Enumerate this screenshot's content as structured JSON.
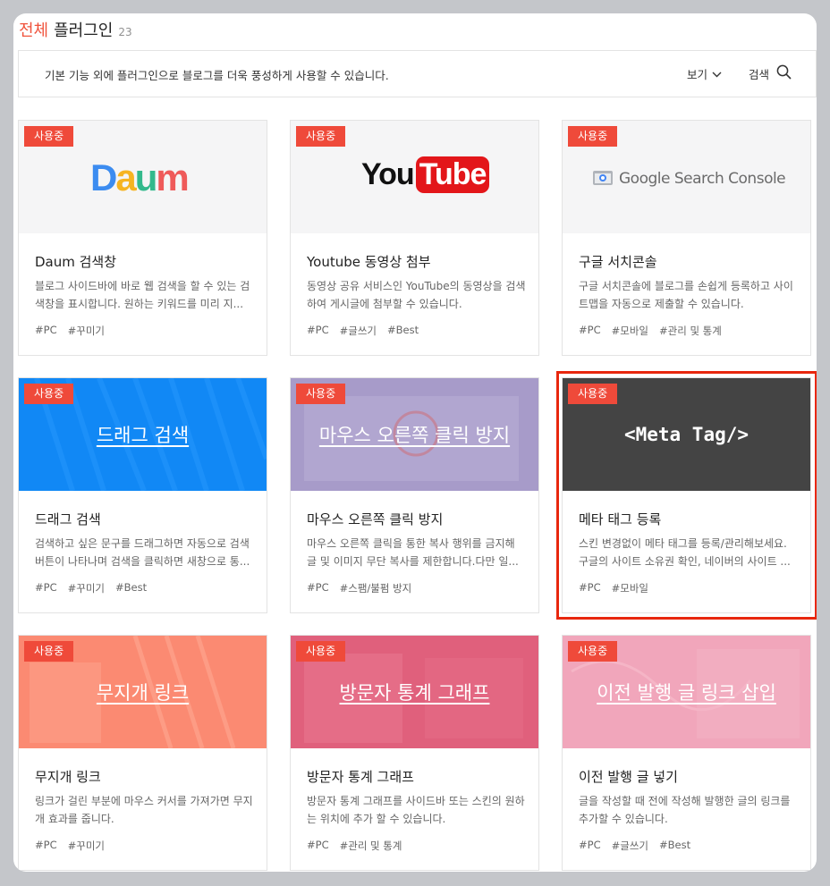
{
  "header": {
    "all_label": "전체",
    "plugin_label": "플러그인",
    "count": "23"
  },
  "toolbar": {
    "description": "기본 기능 외에 플러그인으로 블로그를 더욱 풍성하게 사용할 수 있습니다.",
    "view_label": "보기",
    "search_label": "검색"
  },
  "cards": [
    {
      "badge": "사용중",
      "logo": "Daum",
      "title": "Daum 검색창",
      "desc": "블로그 사이드바에 바로 웹 검색을 할 수 있는 검색창을 표시합니다. 원하는 키워드를 미리 지...",
      "tags": [
        "#PC",
        "#꾸미기"
      ]
    },
    {
      "badge": "사용중",
      "logo_a": "You",
      "logo_b": "Tube",
      "title": "Youtube 동영상 첨부",
      "desc": "동영상 공유 서비스인 YouTube의 동영상을 검색하여 게시글에 첨부할 수 있습니다.",
      "tags": [
        "#PC",
        "#글쓰기",
        "#Best"
      ]
    },
    {
      "badge": "사용중",
      "logo": "Google Search Console",
      "title": "구글 서치콘솔",
      "desc": "구글 서치콘솔에 블로그를 손쉽게 등록하고 사이트맵을 자동으로 제출할 수 있습니다.",
      "tags": [
        "#PC",
        "#모바일",
        "#관리 및 통계"
      ]
    },
    {
      "badge": "사용중",
      "thumb_text": "드래그 검색",
      "title": "드래그 검색",
      "desc": "검색하고 싶은 문구를 드래그하면 자동으로 검색 버튼이 나타나며 검색을 클릭하면 새창으로 통...",
      "tags": [
        "#PC",
        "#꾸미기",
        "#Best"
      ]
    },
    {
      "badge": "사용중",
      "thumb_text": "마우스 오른쪽 클릭 방지",
      "title": "마우스 오른쪽 클릭 방지",
      "desc": "마우스 오른쪽 클릭을 통한 복사 행위를 금지해 글 및 이미지 무단 복사를 제한합니다.다만 일...",
      "tags": [
        "#PC",
        "#스팸/불펌 방지"
      ]
    },
    {
      "badge": "사용중",
      "thumb_text": "<Meta Tag/>",
      "title": "메타 태그 등록",
      "desc": "스킨 변경없이 메타 태그를 등록/관리해보세요. 구글의 사이트 소유권 확인, 네이버의 사이트 ...",
      "tags": [
        "#PC",
        "#모바일"
      ]
    },
    {
      "badge": "사용중",
      "thumb_text": "무지개 링크",
      "title": "무지개 링크",
      "desc": "링크가 걸린 부분에 마우스 커서를 가져가면 무지개 효과를 줍니다.",
      "tags": [
        "#PC",
        "#꾸미기"
      ]
    },
    {
      "badge": "사용중",
      "thumb_text": "방문자 통계 그래프",
      "title": "방문자 통계 그래프",
      "desc": "방문자 통계 그래프를 사이드바 또는 스킨의 원하는 위치에 추가 할 수 있습니다.",
      "tags": [
        "#PC",
        "#관리 및 통계"
      ]
    },
    {
      "badge": "사용중",
      "thumb_text": "이전 발행 글 링크 삽입",
      "title": "이전 발행 글 넣기",
      "desc": "글을 작성할 때 전에 작성해 발행한 글의 링크를 추가할 수 있습니다.",
      "tags": [
        "#PC",
        "#글쓰기",
        "#Best"
      ]
    }
  ],
  "colors": {
    "accent": "#ef4a3a",
    "drag_bg": "#1188f5",
    "mouse_bg": "#a79bc9",
    "meta_bg": "#444444",
    "rainbow_bg": "#fb8a72",
    "stats_bg": "#e0607c",
    "prev_bg": "#f1a6bb",
    "highlight": "#e8270e"
  }
}
